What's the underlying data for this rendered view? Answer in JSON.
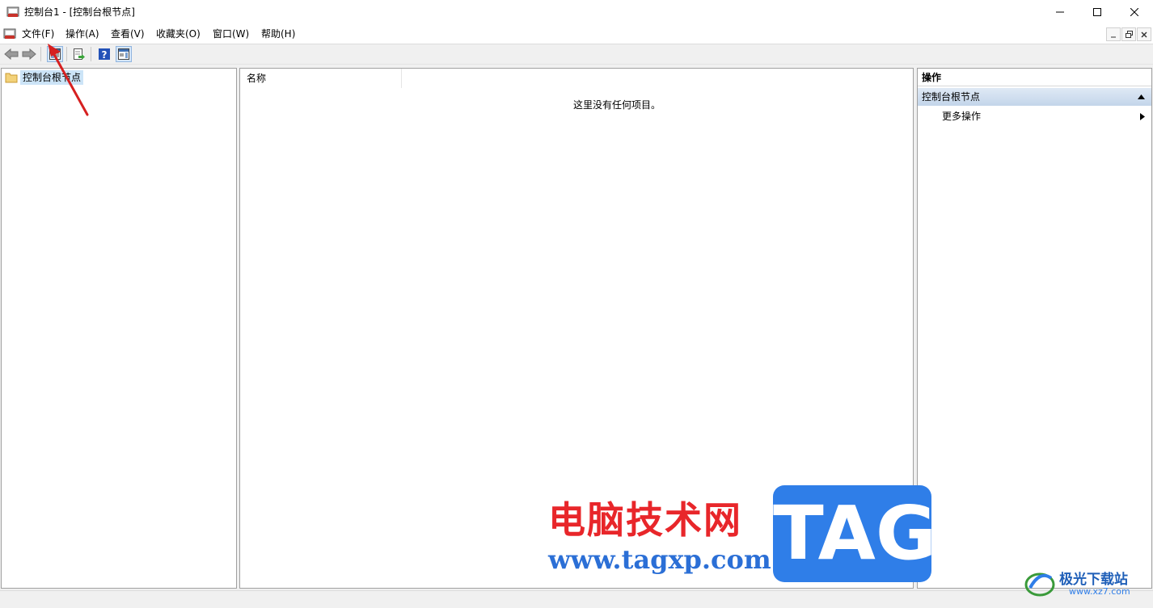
{
  "window": {
    "title": "控制台1 - [控制台根节点]"
  },
  "menu": {
    "items": [
      "文件(F)",
      "操作(A)",
      "查看(V)",
      "收藏夹(O)",
      "窗口(W)",
      "帮助(H)"
    ]
  },
  "tree": {
    "root_label": "控制台根节点"
  },
  "list": {
    "column_name": "名称",
    "empty_message": "这里没有任何项目。"
  },
  "actions": {
    "header": "操作",
    "section_title": "控制台根节点",
    "more_actions": "更多操作"
  },
  "watermark": {
    "cn_text": "电脑技术网",
    "url": "www.tagxp.com",
    "tag": "TAG",
    "site_name": "极光下载站",
    "site_url": "www.xz7.com"
  },
  "colors": {
    "selection": "#cce4f7",
    "annotation_arrow": "#d62020",
    "watermark_red": "#e8262a",
    "watermark_blue": "#2f7ee8"
  }
}
